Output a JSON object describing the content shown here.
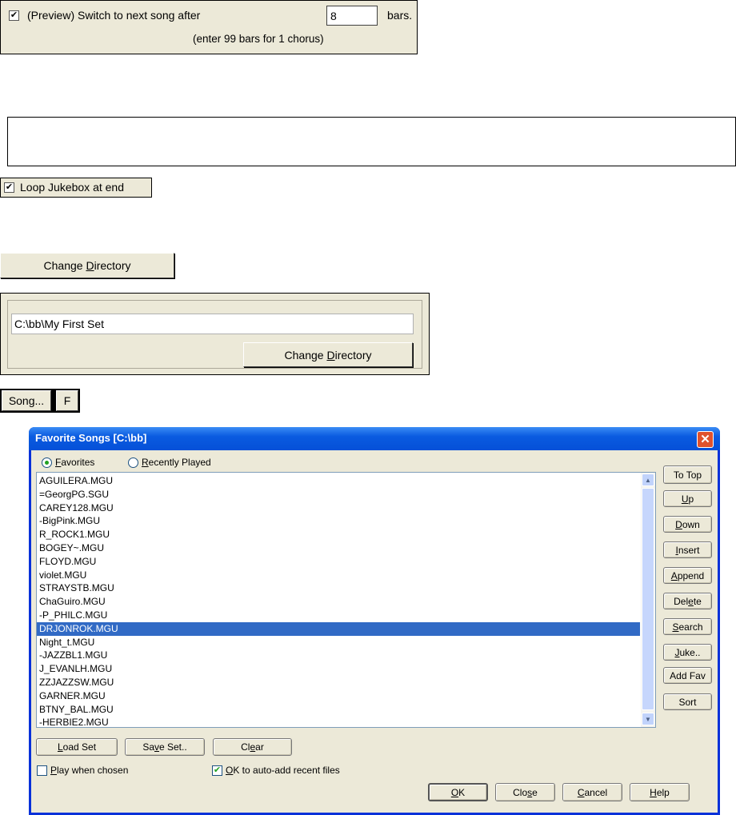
{
  "preview": {
    "label": "(Preview) Switch to next song after",
    "value": "8",
    "suffix": "bars.",
    "hint": "(enter 99 bars for 1 chorus)",
    "checked": true
  },
  "loop": {
    "label": "Loop Jukebox at end",
    "checked": true
  },
  "change_dir_button": {
    "pre": "Change ",
    "key": "D",
    "post": "irectory"
  },
  "dir_panel": {
    "path": "C:\\bb\\My First Set",
    "button": {
      "pre": "Change ",
      "key": "D",
      "post": "irectory"
    }
  },
  "song_buttons": {
    "song": "Song...",
    "f": "F"
  },
  "dialog": {
    "title": "Favorite Songs [C:\\bb]",
    "radio_favorites": {
      "key": "F",
      "rest": "avorites",
      "selected": true
    },
    "radio_recent": {
      "key": "R",
      "rest": "ecently Played",
      "selected": false
    },
    "songs": [
      "AGUILERA.MGU",
      "=GeorgPG.SGU",
      "CAREY128.MGU",
      "-BigPink.MGU",
      "R_ROCK1.MGU",
      "BOGEY~.MGU",
      "FLOYD.MGU",
      "violet.MGU",
      "STRAYSTB.MGU",
      "ChaGuiro.MGU",
      "-P_PHILC.MGU",
      "DRJONROK.MGU",
      "Night_t.MGU",
      "-JAZZBL1.MGU",
      "J_EVANLH.MGU",
      "ZZJAZZSW.MGU",
      "GARNER.MGU",
      "BTNY_BAL.MGU",
      "-HERBIE2.MGU"
    ],
    "selected_index": 11,
    "side_buttons": {
      "to_top": "To Top",
      "up": {
        "pre": "",
        "key": "U",
        "post": "p"
      },
      "down": {
        "pre": "",
        "key": "D",
        "post": "own"
      },
      "insert": {
        "pre": "",
        "key": "I",
        "post": "nsert"
      },
      "append": {
        "pre": "",
        "key": "A",
        "post": "ppend"
      },
      "delete": {
        "pre": "Del",
        "key": "e",
        "post": "te"
      },
      "search": {
        "pre": "",
        "key": "S",
        "post": "earch"
      },
      "juke": {
        "pre": "",
        "key": "J",
        "post": "uke.."
      },
      "add_fav": "Add Fav",
      "sort": "Sort"
    },
    "bottom_buttons": {
      "load_set": {
        "pre": "",
        "key": "L",
        "post": "oad Set"
      },
      "save_set": {
        "pre": "Sa",
        "key": "v",
        "post": "e Set.."
      },
      "clear": {
        "pre": "Cl",
        "key": "e",
        "post": "ar"
      }
    },
    "play_when_chosen": {
      "pre": "",
      "key": "P",
      "post": "lay when chosen",
      "checked": false
    },
    "auto_add": {
      "pre": "",
      "key": "O",
      "post": "K to auto-add recent files",
      "checked": true
    },
    "footer_buttons": {
      "ok": {
        "pre": "",
        "key": "O",
        "post": "K"
      },
      "close": {
        "pre": "Clo",
        "key": "s",
        "post": "e"
      },
      "cancel": {
        "pre": "",
        "key": "C",
        "post": "ancel"
      },
      "help": {
        "pre": "",
        "key": "H",
        "post": "elp"
      }
    }
  }
}
